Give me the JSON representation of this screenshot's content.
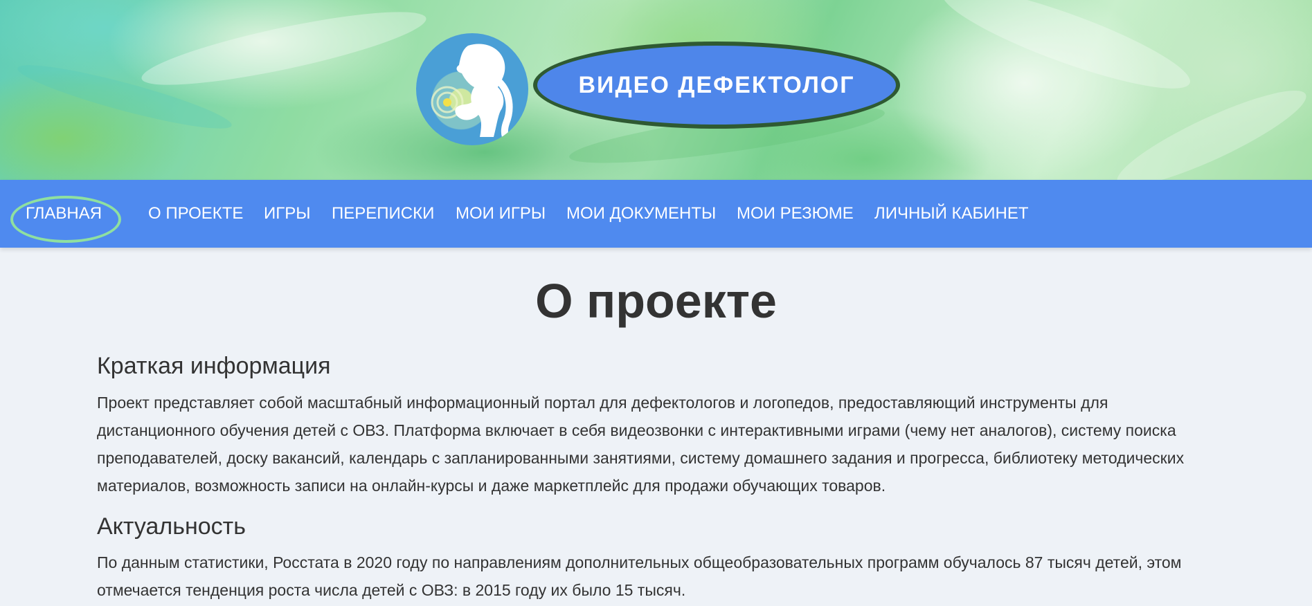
{
  "header": {
    "site_title": "ВИДЕО ДЕФЕКТОЛОГ",
    "logo_icon": "girl-silhouette-logo-icon"
  },
  "nav": {
    "items": [
      {
        "label": "ГЛАВНАЯ",
        "active": true
      },
      {
        "label": "О ПРОЕКТЕ"
      },
      {
        "label": "ИГРЫ"
      },
      {
        "label": "ПЕРЕПИСКИ"
      },
      {
        "label": "МОИ ИГРЫ"
      },
      {
        "label": "МОИ ДОКУМЕНТЫ"
      },
      {
        "label": "МОИ РЕЗЮМЕ"
      },
      {
        "label": "ЛИЧНЫЙ КАБИНЕТ"
      }
    ]
  },
  "main": {
    "title": "О проекте",
    "sections": [
      {
        "heading": "Краткая информация",
        "text": "Проект представляет собой масштабный информационный портал для дефектологов и логопедов, предоставляющий инструменты для дистанционного обучения детей с ОВЗ. Платформа включает в себя видеозвонки с интерактивными играми (чему нет аналогов), систему поиска преподавателей, доску вакансий, календарь с запланированными занятиями, систему домашнего задания и прогресса, библиотеку методических материалов, возможность записи на онлайн-курсы и даже маркетплейс для продажи обучающих товаров."
      },
      {
        "heading": "Актуальность",
        "text": "По данным статистики, Росстата в 2020 году по направлениям дополнительных общеобразовательных программ обучалось 87 тысяч детей, этом отмечается тенденция роста числа детей с ОВЗ: в 2015 году их было 15 тысяч."
      }
    ]
  },
  "colors": {
    "nav_background": "#4f8aef",
    "title_oval": "#4e86ea",
    "title_oval_border": "#2f5a32",
    "active_highlight": "#8fe0a0",
    "page_background": "#eef2f7",
    "text": "#333333"
  }
}
